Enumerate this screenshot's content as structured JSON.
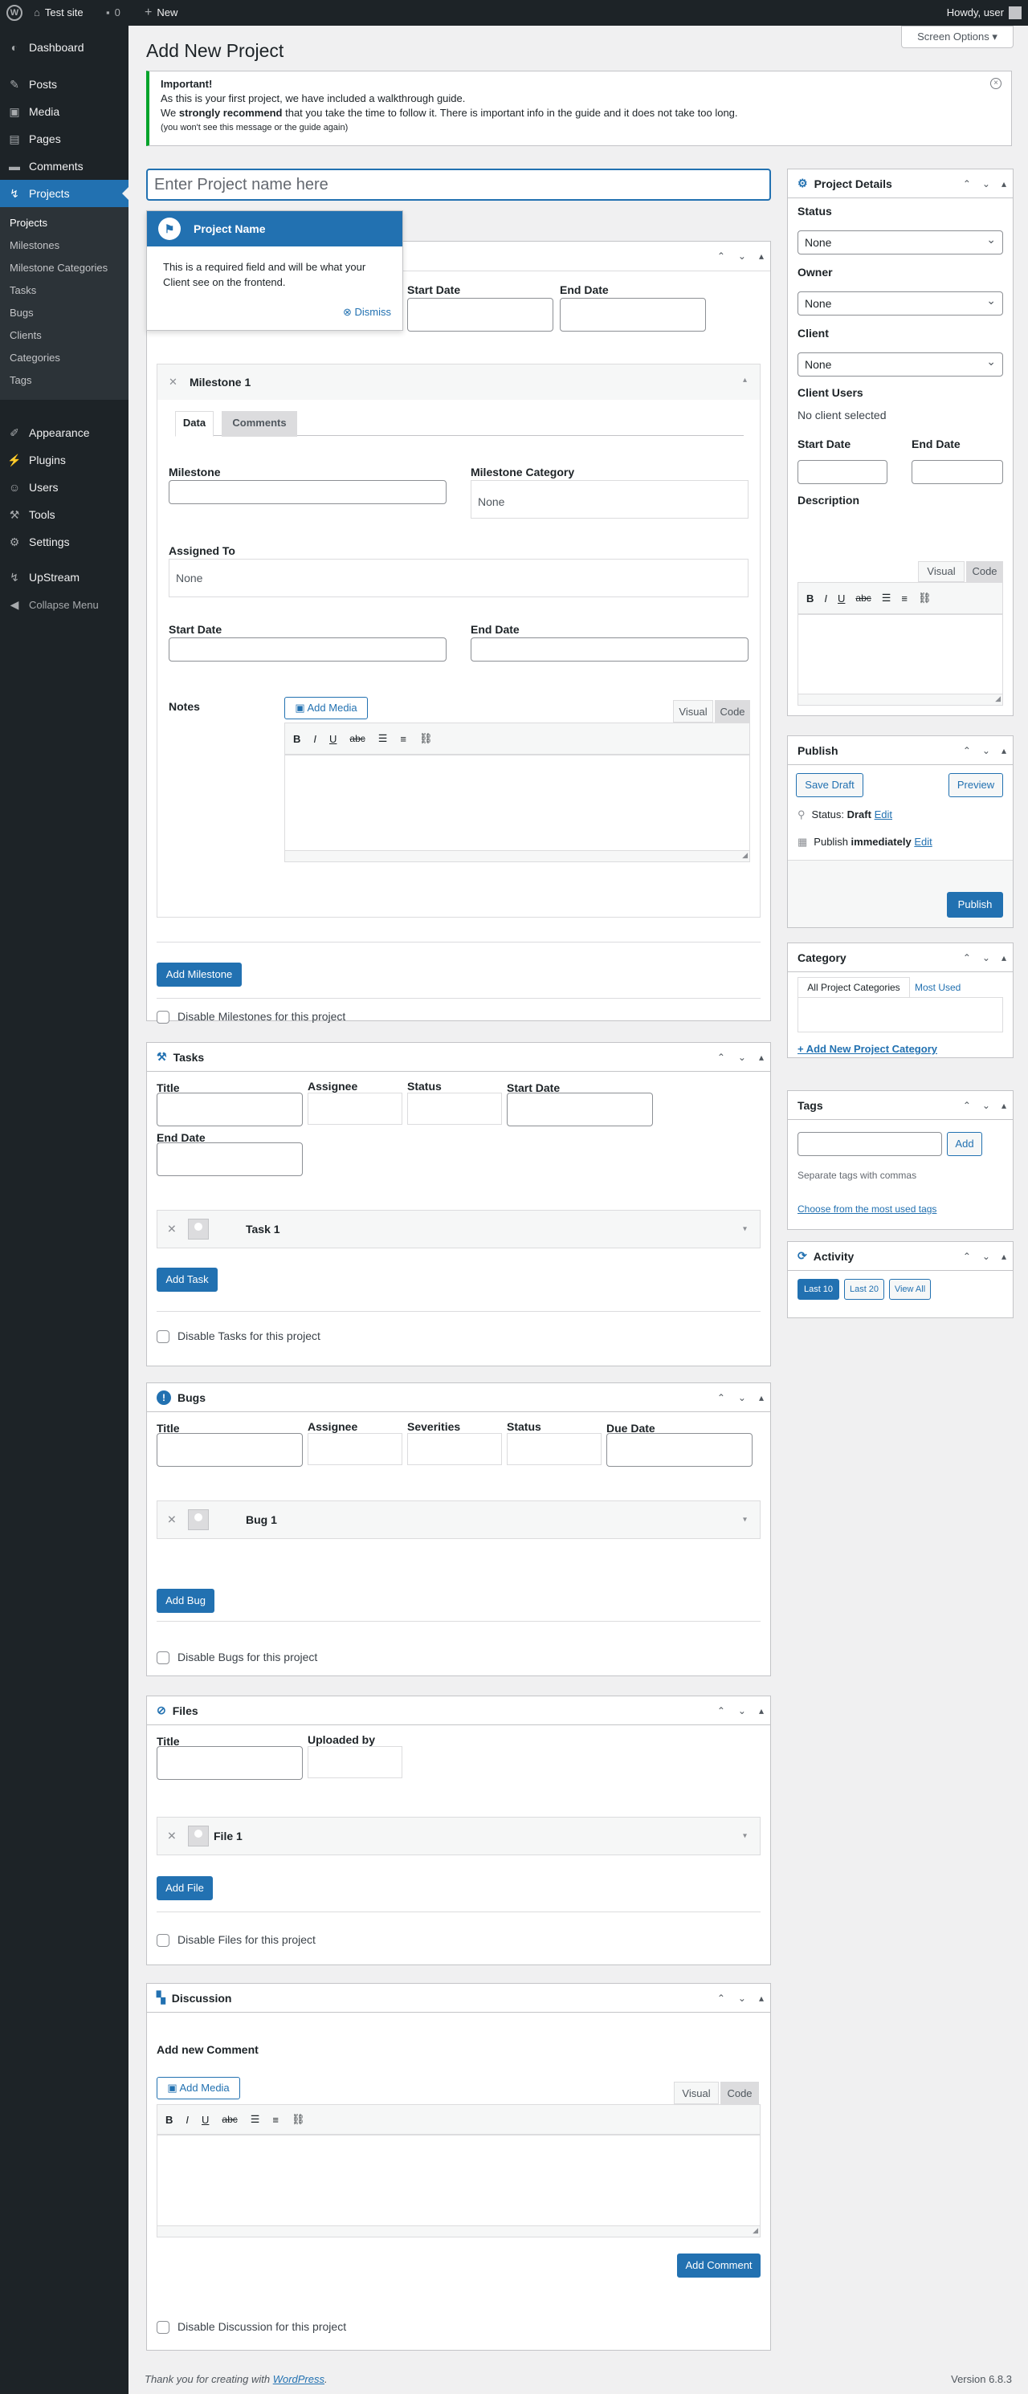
{
  "adminbar": {
    "site": "Test site",
    "comments": "0",
    "new": "New",
    "howdy": "Howdy, user"
  },
  "menu": {
    "dashboard": "Dashboard",
    "posts": "Posts",
    "media": "Media",
    "pages": "Pages",
    "comments": "Comments",
    "projects": "Projects",
    "sub": [
      "Projects",
      "Milestones",
      "Milestone Categories",
      "Tasks",
      "Bugs",
      "Clients",
      "Categories",
      "Tags"
    ],
    "appearance": "Appearance",
    "plugins": "Plugins",
    "users": "Users",
    "tools": "Tools",
    "settings": "Settings",
    "upstream": "UpStream",
    "collapse": "Collapse Menu"
  },
  "screen_options": "Screen Options",
  "page_title": "Add New Project",
  "notice": {
    "title": "Important!",
    "line1": "As this is your first project, we have included a walkthrough guide.",
    "line2a": "We ",
    "line2b": "strongly recommend",
    "line2c": " that you take the time to follow it. There is important info in the guide and it does not take too long.",
    "line3": "(you won't see this message or the guide again)"
  },
  "title_placeholder": "Enter Project name here",
  "pointer": {
    "title": "Project Name",
    "body": "This is a required field and will be what your Client see on the frontend.",
    "dismiss": "Dismiss"
  },
  "milestones": {
    "start_date": "Start Date",
    "end_date": "End Date",
    "item_title": "Milestone 1",
    "tab_data": "Data",
    "tab_comments": "Comments",
    "milestone": "Milestone",
    "category": "Milestone Category",
    "category_value": "None",
    "assigned": "Assigned To",
    "assigned_value": "None",
    "start": "Start Date",
    "end": "End Date",
    "notes": "Notes",
    "add_media": "Add Media",
    "visual": "Visual",
    "code": "Code",
    "add": "Add Milestone",
    "disable": "Disable Milestones for this project"
  },
  "tasks": {
    "title": "Tasks",
    "cols": [
      "Title",
      "Assignee",
      "Status",
      "Start Date"
    ],
    "end_date": "End Date",
    "item": "Task 1",
    "add": "Add Task",
    "disable": "Disable Tasks for this project"
  },
  "bugs": {
    "title": "Bugs",
    "cols": [
      "Title",
      "Assignee",
      "Severities",
      "Status",
      "Due Date"
    ],
    "item": "Bug 1",
    "add": "Add Bug",
    "disable": "Disable Bugs for this project"
  },
  "files": {
    "title": "Files",
    "cols": [
      "Title",
      "Uploaded by"
    ],
    "item": "File 1",
    "add": "Add File",
    "disable": "Disable Files for this project"
  },
  "discussion": {
    "title": "Discussion",
    "add_new": "Add new Comment",
    "add_media": "Add Media",
    "visual": "Visual",
    "code": "Code",
    "add": "Add Comment",
    "disable": "Disable Discussion for this project"
  },
  "details": {
    "title": "Project Details",
    "status": "Status",
    "status_value": "None",
    "owner": "Owner",
    "owner_value": "None",
    "client": "Client",
    "client_value": "None",
    "client_users": "Client Users",
    "no_client": "No client selected",
    "start": "Start Date",
    "end": "End Date",
    "description": "Description",
    "visual": "Visual",
    "code": "Code"
  },
  "publish": {
    "title": "Publish",
    "save": "Save Draft",
    "preview": "Preview",
    "status_label": "Status: ",
    "status_value": "Draft",
    "edit": "Edit",
    "publish_label": "Publish ",
    "publish_value": "immediately",
    "edit2": "Edit",
    "button": "Publish"
  },
  "category": {
    "title": "Category",
    "tab_all": "All Project Categories",
    "tab_most": "Most Used",
    "add_new": "+ Add New Project Category"
  },
  "tags": {
    "title": "Tags",
    "add": "Add",
    "hint": "Separate tags with commas",
    "choose": "Choose from the most used tags"
  },
  "activity": {
    "title": "Activity",
    "last10": "Last 10",
    "last20": "Last 20",
    "all": "View All"
  },
  "footer": {
    "thanks": "Thank you for creating with ",
    "wp": "WordPress",
    "dot": ".",
    "version": "Version 6.8.3"
  },
  "colors": {
    "accent": "#2271b1",
    "sidebar": "#1d2327",
    "notice": "#00a32a"
  }
}
